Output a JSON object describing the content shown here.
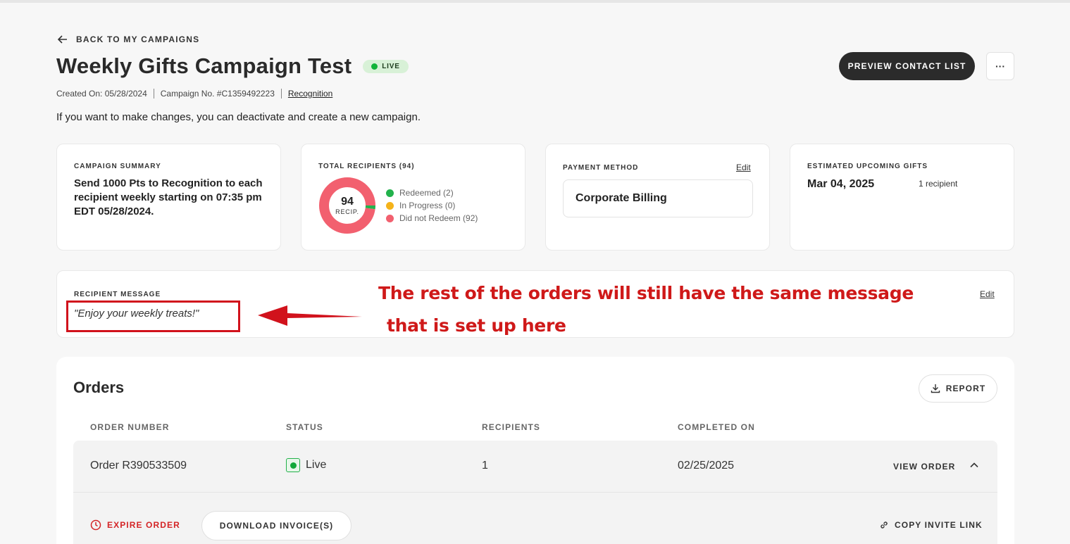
{
  "header": {
    "back_label": "BACK TO MY CAMPAIGNS",
    "title": "Weekly Gifts Campaign Test",
    "status_badge": "LIVE",
    "created_on": "Created On: 05/28/2024",
    "campaign_no": "Campaign No. #C1359492223",
    "campaign_type": "Recognition",
    "hint": "If you want to make changes, you can deactivate and create a new campaign.",
    "preview_button": "PREVIEW CONTACT LIST",
    "more_button": "···"
  },
  "summary_card": {
    "label": "CAMPAIGN SUMMARY",
    "text": "Send 1000 Pts to Recognition to each recipient weekly starting on 07:35 pm EDT 05/28/2024."
  },
  "recipients_card": {
    "label": "TOTAL RECIPIENTS (94)",
    "total": "94",
    "unit": "RECIP.",
    "legend": [
      {
        "label": "Redeemed (2)",
        "count": 2,
        "color": "#22b24c"
      },
      {
        "label": "In Progress (0)",
        "count": 0,
        "color": "#f5b31a"
      },
      {
        "label": "Did not Redeem (92)",
        "count": 92,
        "color": "#f2606f"
      }
    ]
  },
  "payment_card": {
    "label": "PAYMENT METHOD",
    "edit": "Edit",
    "method": "Corporate Billing"
  },
  "upcoming_card": {
    "label": "ESTIMATED UPCOMING GIFTS",
    "date": "Mar 04, 2025",
    "count": "1 recipient"
  },
  "message_card": {
    "label": "RECIPIENT MESSAGE",
    "text": "\"Enjoy your weekly treats!\"",
    "edit": "Edit"
  },
  "annotation": {
    "line1": "The rest of the orders will still have the same message",
    "line2": "that is set up here",
    "color": "#cf1919"
  },
  "orders": {
    "title": "Orders",
    "report_button": "REPORT",
    "columns": [
      "ORDER NUMBER",
      "STATUS",
      "RECIPIENTS",
      "COMPLETED ON"
    ],
    "rows": [
      {
        "order_number": "Order R390533509",
        "status": "Live",
        "recipients": "1",
        "completed_on": "02/25/2025",
        "view_label": "VIEW ORDER"
      }
    ],
    "expire_label": "EXPIRE ORDER",
    "invoice_button": "DOWNLOAD INVOICE(S)",
    "copy_link_label": "COPY INVITE LINK"
  }
}
